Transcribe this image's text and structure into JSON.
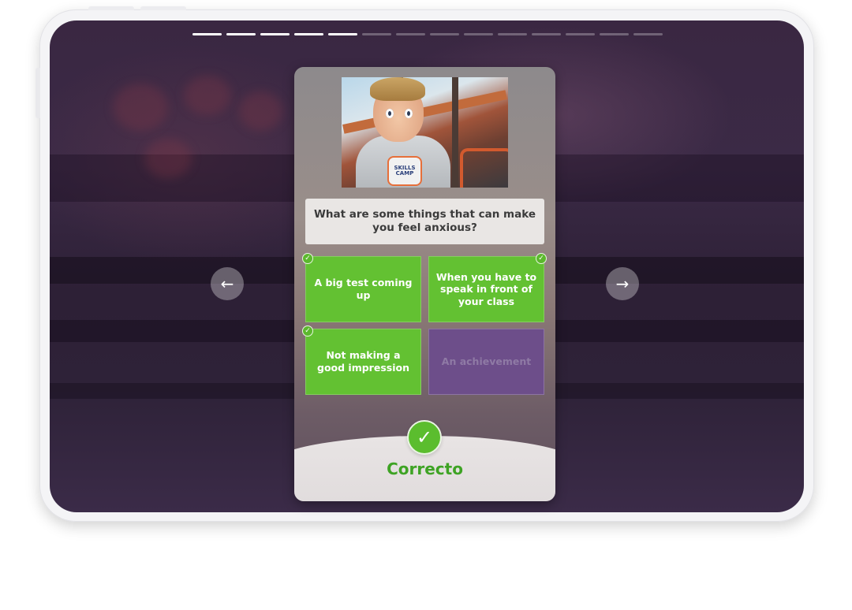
{
  "progress": {
    "total_segments": 14,
    "completed_segments": 5
  },
  "navigation": {
    "prev_icon": "←",
    "next_icon": "→"
  },
  "image": {
    "shirt_logo_text": "SKILLS CAMP"
  },
  "question": {
    "text": "What are some things that can make you feel anxious?"
  },
  "options": [
    {
      "label": "A big test coming up",
      "color": "green",
      "checked": true
    },
    {
      "label": "When you have to speak in front of your class",
      "color": "green",
      "checked": true
    },
    {
      "label": "Not making a good impression",
      "color": "green",
      "checked": true
    },
    {
      "label": "An achievement",
      "color": "purple",
      "checked": false
    }
  ],
  "result": {
    "label": "Correcto",
    "icon": "check-icon"
  },
  "colors": {
    "correct_green": "#63c132",
    "wrong_purple": "#6d4e8a",
    "result_text_green": "#3ea324"
  }
}
